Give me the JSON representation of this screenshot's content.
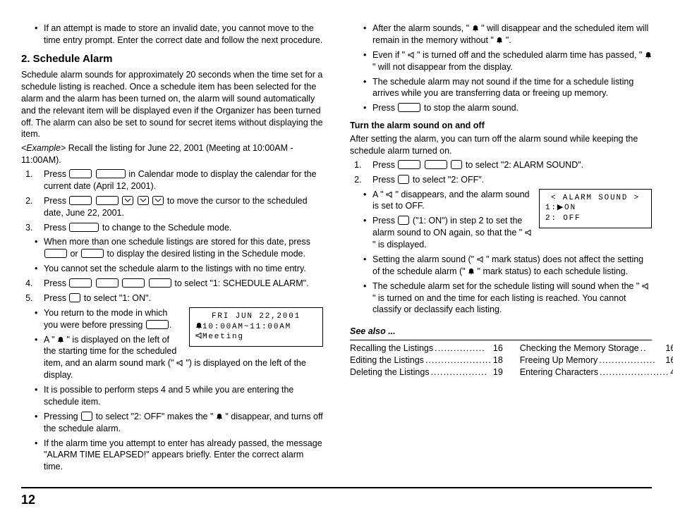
{
  "left": {
    "top_bullet": "If an attempt is made to store an invalid date, you cannot move to the time entry prompt. Enter the correct date and follow the next procedure.",
    "heading": "2. Schedule Alarm",
    "intro": "Schedule alarm sounds for approximately 20 seconds when the time set for a schedule listing is reached. Once a schedule item has been selected for the alarm and the alarm has been turned on, the alarm will sound automatically and the relevant item will be displayed even if the Organizer has been turned off. The alarm can also be set to sound for secret items without displaying the item.",
    "example_label": "<Example>",
    "example_text": " Recall the listing for June 22, 2001 (Meeting at 10:00AM - 11:00AM).",
    "step1a": "Press ",
    "step1b": " in Calendar mode to display the calendar for the current date (April 12, 2001).",
    "step2a": "Press ",
    "step2b": " to move the cursor to the scheduled date, June 22, 2001.",
    "step3a": "Press ",
    "step3b": " to change to the Schedule mode.",
    "bullet_more1a": "When more than one schedule listings are stored for this date, press ",
    "bullet_more1b": " or ",
    "bullet_more1c": " to display the desired listing in the Schedule mode.",
    "bullet_more2": "You cannot set the schedule alarm to the listings with no time entry.",
    "step4a": "Press ",
    "step4b": " to select \"1: SCHEDULE ALARM\".",
    "step5a": "Press ",
    "step5b": " to select \"1: ON\".",
    "bullet_return_a": "You return to the mode in which you were before pressing ",
    "bullet_return_b": ".",
    "bullet_bell_a": "A \" ",
    "bullet_bell_b": " \" is displayed on the left of the starting time for the scheduled item, and an alarm sound mark (\" ",
    "bullet_bell_c": " \") is displayed on the left of the display.",
    "bullet_perform": "It is possible to perform steps 4 and 5 while you are entering the schedule item.",
    "bullet_off_a": "Pressing ",
    "bullet_off_b": " to select \"2: OFF\" makes the \" ",
    "bullet_off_c": " \" disappear, and turns off the schedule alarm.",
    "bullet_elapsed": "If the alarm time you attempt to enter has already passed, the message \"ALARM TIME ELAPSED!\" appears briefly. Enter the correct alarm time.",
    "screen": {
      "l1": "FRI JUN 22,2001",
      "l2": "10:00AM~11:00AM",
      "l3": "Meeting"
    }
  },
  "right": {
    "bullet1a": "After the alarm sounds, \" ",
    "bullet1b": " \" will disappear and the scheduled item will remain in the memory without \" ",
    "bullet1c": " \".",
    "bullet2a": "Even if \" ",
    "bullet2b": " \" is turned off and the scheduled alarm time has passed, \" ",
    "bullet2c": " \" will not disappear from the display.",
    "bullet3": "The schedule alarm may not sound if the time for a schedule listing arrives while you are transferring data or freeing up memory.",
    "bullet4a": "Press ",
    "bullet4b": " to stop the alarm sound.",
    "h3": "Turn the alarm sound on and off",
    "h3_intro": "After setting the alarm, you can turn off the alarm sound while keeping the schedule alarm turned on.",
    "r_step1a": "Press ",
    "r_step1b": " to select \"2: ALARM SOUND\".",
    "r_step2a": "Press ",
    "r_step2b": " to select \"2: OFF\".",
    "r_bullet1a": "A \" ",
    "r_bullet1b": " \" disappears, and the alarm sound is set to OFF.",
    "r_bullet2a": "Press ",
    "r_bullet2b": " (\"1: ON\") in step 2 to set the alarm sound to ON again, so that the \" ",
    "r_bullet2c": " \" is displayed.",
    "r_bullet3a": "Setting the alarm sound (\" ",
    "r_bullet3b": " \" mark status) does not affect the setting of the schedule alarm (\" ",
    "r_bullet3c": " \" mark status) to each schedule listing.",
    "r_bullet4a": "The schedule alarm set for the schedule listing will sound when the \" ",
    "r_bullet4b": " \" is turned on and the time for each listing is reached. You cannot classify or declassify each listing.",
    "screen2": {
      "l1": "< ALARM SOUND >",
      "l2": "1:▶ON",
      "l3": "2: OFF"
    },
    "see_also": "See also ...",
    "see_left": [
      {
        "label": "Recalling the Listings",
        "page": "16"
      },
      {
        "label": "Editing the Listings",
        "page": "18"
      },
      {
        "label": "Deleting the Listings",
        "page": "19"
      }
    ],
    "see_right": [
      {
        "label": "Checking the Memory Storage",
        "page": "16"
      },
      {
        "label": "Freeing Up Memory",
        "page": "16"
      },
      {
        "label": "Entering Characters",
        "page": "4"
      }
    ]
  },
  "page_num": "12"
}
